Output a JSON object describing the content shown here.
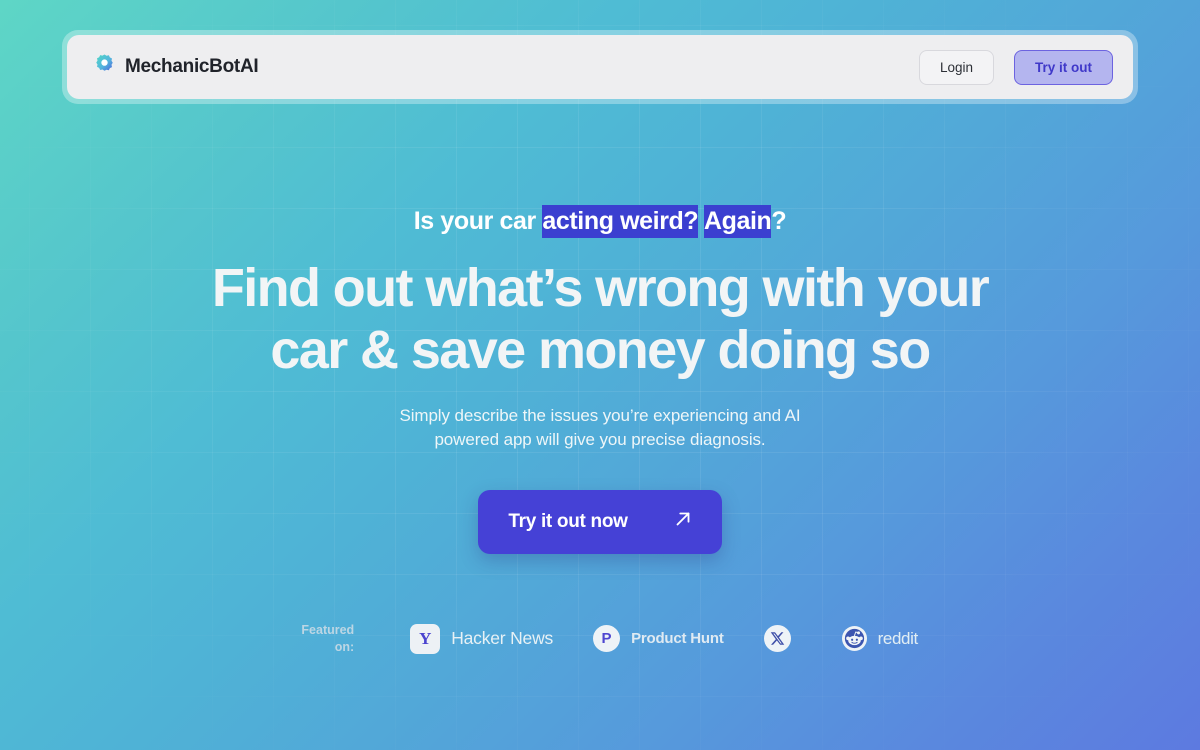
{
  "brand": {
    "name": "MechanicBotAI",
    "logo_icon": "gear-icon"
  },
  "nav": {
    "login_label": "Login",
    "tryout_label": "Try it out"
  },
  "hero": {
    "eyebrow_prefix": "Is your car ",
    "eyebrow_highlight_1": "acting weird?",
    "eyebrow_space": " ",
    "eyebrow_highlight_2": "Again",
    "eyebrow_suffix": "?",
    "headline_line1": "Find out what’s wrong with your",
    "headline_line2": "car & save money doing so",
    "subtitle_line1": "Simply describe the issues you’re experiencing and AI",
    "subtitle_line2": "powered app will give you precise diagnosis.",
    "cta_label": "Try it out now",
    "cta_icon": "arrow-up-right-icon"
  },
  "featured": {
    "label_line1": "Featured",
    "label_line2": "on:",
    "logos": [
      {
        "id": "hacker-news",
        "badge_glyph": "Y",
        "label": "Hacker News",
        "icon": "hacker-news-icon"
      },
      {
        "id": "product-hunt",
        "badge_glyph": "P",
        "label": "Product Hunt",
        "icon": "product-hunt-icon"
      },
      {
        "id": "x-twitter",
        "badge_glyph": "",
        "label": "",
        "icon": "x-twitter-icon"
      },
      {
        "id": "reddit",
        "badge_glyph": "",
        "label": "reddit",
        "icon": "reddit-icon"
      }
    ]
  },
  "colors": {
    "gradient_start": "#5ed6c6",
    "gradient_end": "#5d7ae0",
    "accent_purple": "#4541d6",
    "selection_highlight": "#3b3fd0",
    "navbar_panel": "#eeeef0"
  }
}
